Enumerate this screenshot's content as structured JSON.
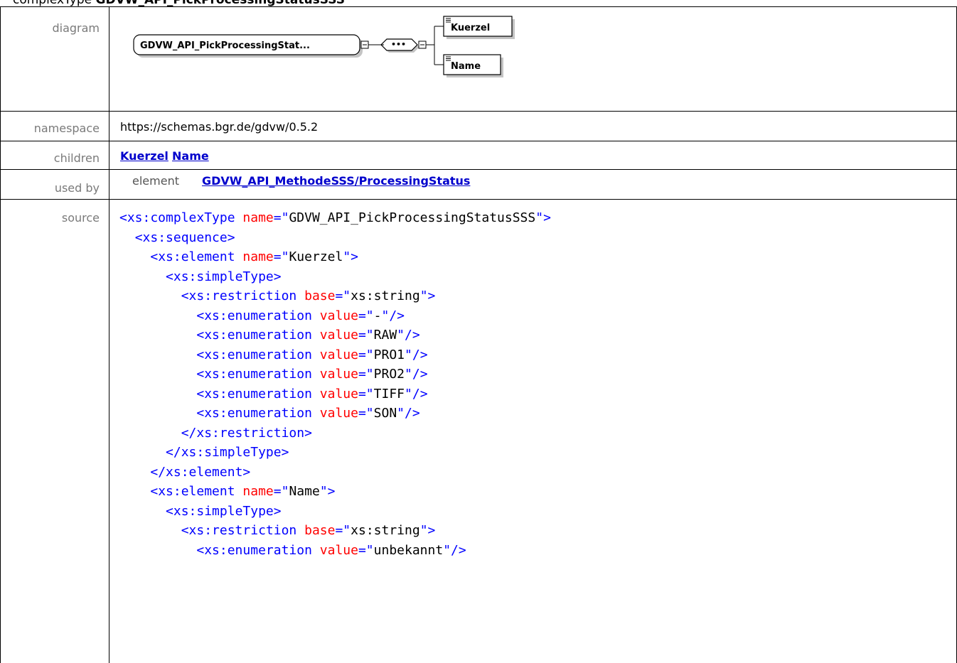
{
  "title": {
    "prefix": "complexType",
    "name": "GDVW_API_PickProcessingStatusSSS"
  },
  "labels": {
    "diagram": "diagram",
    "namespace": "namespace",
    "children": "children",
    "used_by": "used by",
    "source": "source"
  },
  "diagram": {
    "type_box": "GDVW_API_PickProcessingStat...",
    "sequence_symbol": "•••",
    "elements": [
      "Kuerzel",
      "Name"
    ]
  },
  "namespace": "https://schemas.bgr.de/gdvw/0.5.2",
  "children": [
    "Kuerzel",
    "Name"
  ],
  "used_by": {
    "kind": "element",
    "target": "GDVW_API_MethodeSSS/ProcessingStatus"
  },
  "source": {
    "lines": [
      {
        "indent": "",
        "open": "<",
        "tag": "xs:complexType",
        "attr": "name",
        "val": "GDVW_API_PickProcessingStatusSSS",
        "close": "\">"
      },
      {
        "indent": "  ",
        "open": "<",
        "tag": "xs:sequence",
        "attr": "",
        "val": "",
        "close": ">"
      },
      {
        "indent": "    ",
        "open": "<",
        "tag": "xs:element",
        "attr": "name",
        "val": "Kuerzel",
        "close": "\">"
      },
      {
        "indent": "      ",
        "open": "<",
        "tag": "xs:simpleType",
        "attr": "",
        "val": "",
        "close": ">"
      },
      {
        "indent": "        ",
        "open": "<",
        "tag": "xs:restriction",
        "attr": "base",
        "val": "xs:string",
        "close": "\">"
      },
      {
        "indent": "          ",
        "open": "<",
        "tag": "xs:enumeration",
        "attr": "value",
        "val": "-",
        "close": "\"/>"
      },
      {
        "indent": "          ",
        "open": "<",
        "tag": "xs:enumeration",
        "attr": "value",
        "val": "RAW",
        "close": "\"/>"
      },
      {
        "indent": "          ",
        "open": "<",
        "tag": "xs:enumeration",
        "attr": "value",
        "val": "PRO1",
        "close": "\"/>"
      },
      {
        "indent": "          ",
        "open": "<",
        "tag": "xs:enumeration",
        "attr": "value",
        "val": "PRO2",
        "close": "\"/>"
      },
      {
        "indent": "          ",
        "open": "<",
        "tag": "xs:enumeration",
        "attr": "value",
        "val": "TIFF",
        "close": "\"/>"
      },
      {
        "indent": "          ",
        "open": "<",
        "tag": "xs:enumeration",
        "attr": "value",
        "val": "SON",
        "close": "\"/>"
      },
      {
        "indent": "        ",
        "open": "</",
        "tag": "xs:restriction",
        "attr": "",
        "val": "",
        "close": ">"
      },
      {
        "indent": "      ",
        "open": "</",
        "tag": "xs:simpleType",
        "attr": "",
        "val": "",
        "close": ">"
      },
      {
        "indent": "    ",
        "open": "</",
        "tag": "xs:element",
        "attr": "",
        "val": "",
        "close": ">"
      },
      {
        "indent": "    ",
        "open": "<",
        "tag": "xs:element",
        "attr": "name",
        "val": "Name",
        "close": "\">"
      },
      {
        "indent": "      ",
        "open": "<",
        "tag": "xs:simpleType",
        "attr": "",
        "val": "",
        "close": ">"
      },
      {
        "indent": "        ",
        "open": "<",
        "tag": "xs:restriction",
        "attr": "base",
        "val": "xs:string",
        "close": "\">"
      },
      {
        "indent": "          ",
        "open": "<",
        "tag": "xs:enumeration",
        "attr": "value",
        "val": "unbekannt",
        "close": "\"/>"
      }
    ]
  }
}
